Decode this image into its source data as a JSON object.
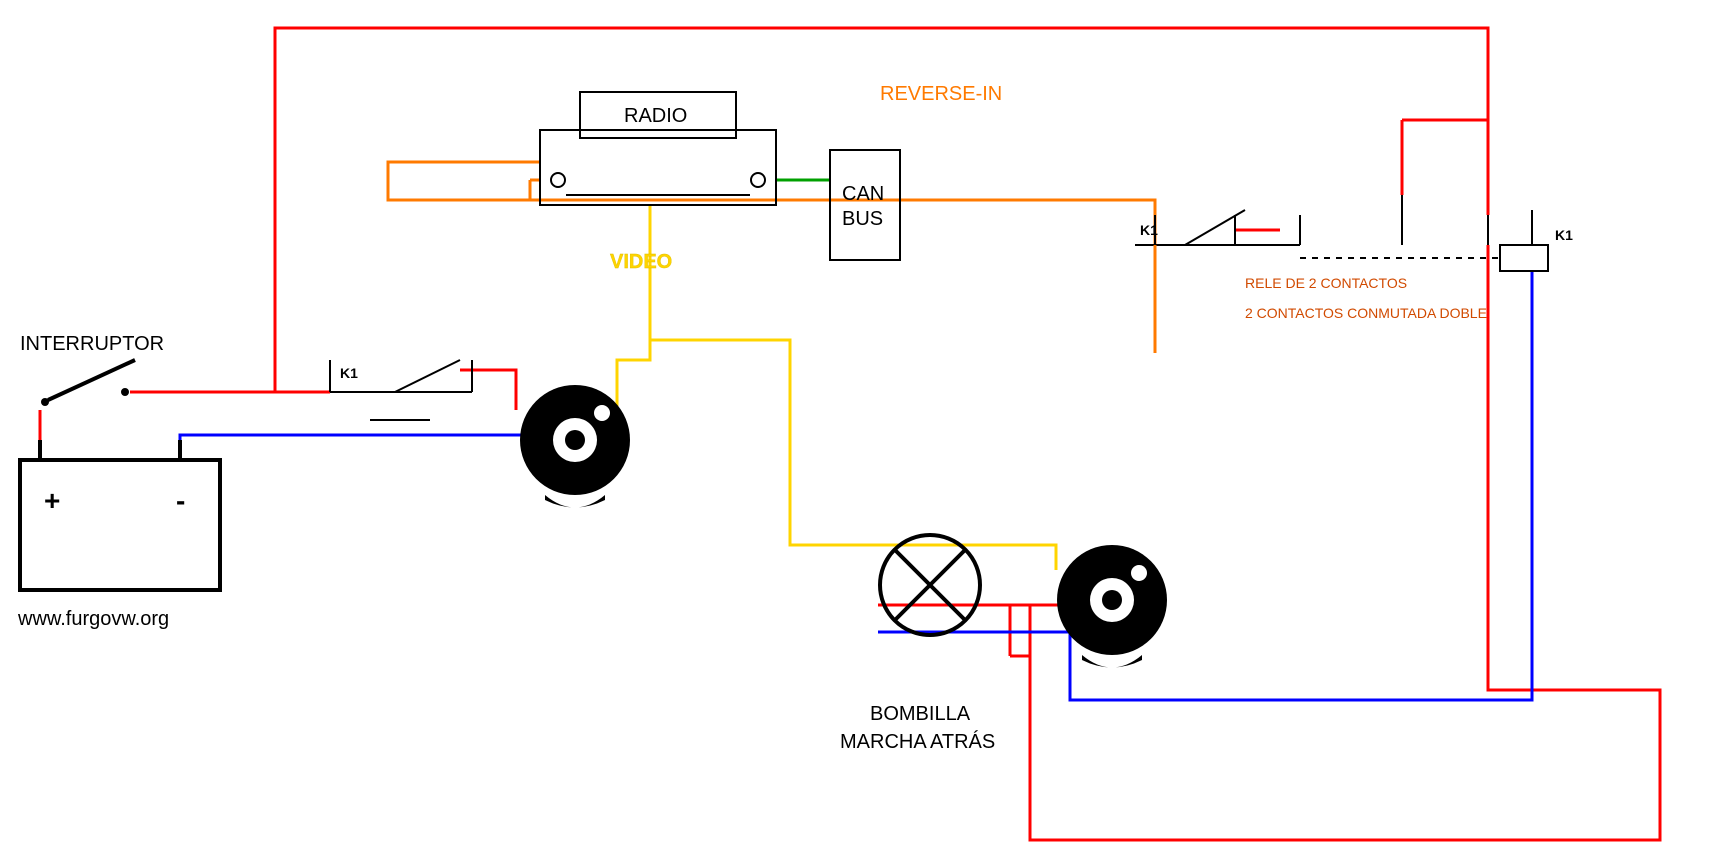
{
  "labels": {
    "interruptor": "INTERRUPTOR",
    "radio": "RADIO",
    "canbus_l1": "CAN",
    "canbus_l2": "BUS",
    "reverse_in": "REVERSE-IN",
    "video": "VIDEO",
    "bombilla_l1": "BOMBILLA",
    "bombilla_l2": "MARCHA ATRÁS",
    "relay_l1": "RELE DE 2 CONTACTOS",
    "relay_l2": "2 CONTACTOS CONMUTADA DOBLE",
    "k1": "K1",
    "plus": "+",
    "minus": "-",
    "neg": "_",
    "url": "www.furgovw.org"
  },
  "components": {
    "battery": {
      "positive_symbol": "+",
      "negative_symbol": "-"
    },
    "switch1_name": "INTERRUPTOR",
    "switch_k1_label": "K1",
    "radio_unit": "RADIO",
    "canbus_unit": "CAN BUS",
    "lamp": "BOMBILLA MARCHA ATRÁS",
    "relay": "RELE DE 2 CONTACTOS / 2 CONTACTOS CONMUTADA DOBLE",
    "cameras_count": 2
  },
  "wires": {
    "red": "power +12V",
    "blue": "ground / negative",
    "orange": "reverse-in signal",
    "yellow": "video signal",
    "green": "CAN bus data"
  }
}
